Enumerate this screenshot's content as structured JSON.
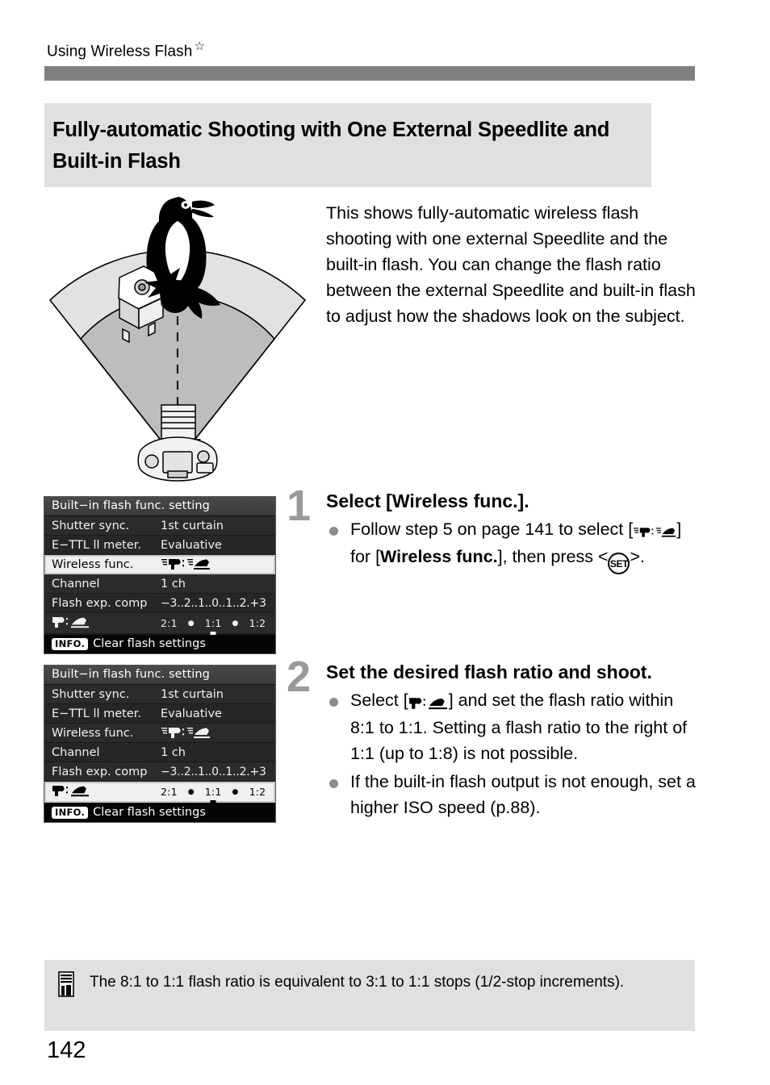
{
  "header": {
    "running_title": "Using Wireless Flash",
    "star_icon": "star-icon",
    "rule_color": "#808080"
  },
  "section": {
    "title": "Fully-automatic Shooting with One External Speedlite and Built-in Flash",
    "band_color": "#e0e0e0"
  },
  "illustration": {
    "name": "wireless-flash-coverage-diagram",
    "elements": [
      "penguin-subject",
      "external-speedlite",
      "camera-with-builtin-flash",
      "flash-coverage-fan",
      "center-axis-dashed-line"
    ]
  },
  "intro": {
    "paragraph": "This shows fully-automatic wireless flash shooting with one external Speedlite and the built-in flash.\nYou can change the flash ratio between the external Speedlite and built-in flash to adjust how the shadows look on the subject."
  },
  "lcd": {
    "title": "Built−in flash func. setting",
    "rows": [
      {
        "label": "Shutter sync.",
        "value": "1st curtain"
      },
      {
        "label": "E−TTL ll meter.",
        "value": "Evaluative"
      },
      {
        "label": "Wireless func.",
        "value": "wireless-speedlite-and-builtin-icon"
      },
      {
        "label": "Channel",
        "value": "1  ch"
      },
      {
        "label": "Flash exp. comp",
        "value": "−3..2..1..0..1..2.+3"
      }
    ],
    "ratio_row": {
      "label": "speedlite-to-builtin-ratio-icon",
      "scale": [
        "2:1",
        "1:1",
        "1:2"
      ],
      "selected": "1:1"
    },
    "footer": {
      "badge": "INFO.",
      "label": "Clear flash settings"
    },
    "screens": [
      {
        "name": "screen-1",
        "selected_row": "Wireless func."
      },
      {
        "name": "screen-2",
        "selected_row": "flash-ratio"
      }
    ]
  },
  "steps": [
    {
      "number": "1",
      "heading": "Select [Wireless func.].",
      "bullets": [
        {
          "parts": [
            {
              "type": "text",
              "text": "Follow step 5 on page 141 to select ["
            },
            {
              "type": "icon",
              "icon": "wireless-speedlite-and-builtin-icon"
            },
            {
              "type": "text",
              "text": "] for ["
            },
            {
              "type": "bold",
              "text": "Wireless func."
            },
            {
              "type": "text",
              "text": "], then press <"
            },
            {
              "type": "key",
              "key": "SET"
            },
            {
              "type": "text",
              "text": ">."
            }
          ]
        }
      ]
    },
    {
      "number": "2",
      "heading": "Set the desired flash ratio and shoot.",
      "bullets": [
        {
          "parts": [
            {
              "type": "text",
              "text": "Select ["
            },
            {
              "type": "icon",
              "icon": "speedlite-to-builtin-ratio-icon"
            },
            {
              "type": "text",
              "text": "] and set the flash ratio within 8:1 to 1:1. Setting a flash ratio to the right of 1:1 (up to 1:8) is not possible."
            }
          ]
        },
        {
          "parts": [
            {
              "type": "text",
              "text": "If the built-in flash output is not enough, set a higher ISO speed (p.88)."
            }
          ]
        }
      ]
    }
  ],
  "note": {
    "icon": "note-memo-icon",
    "text": "The 8:1 to 1:1 flash ratio is equivalent to 3:1 to 1:1 stops (1/2-stop increments)."
  },
  "folio": "142"
}
